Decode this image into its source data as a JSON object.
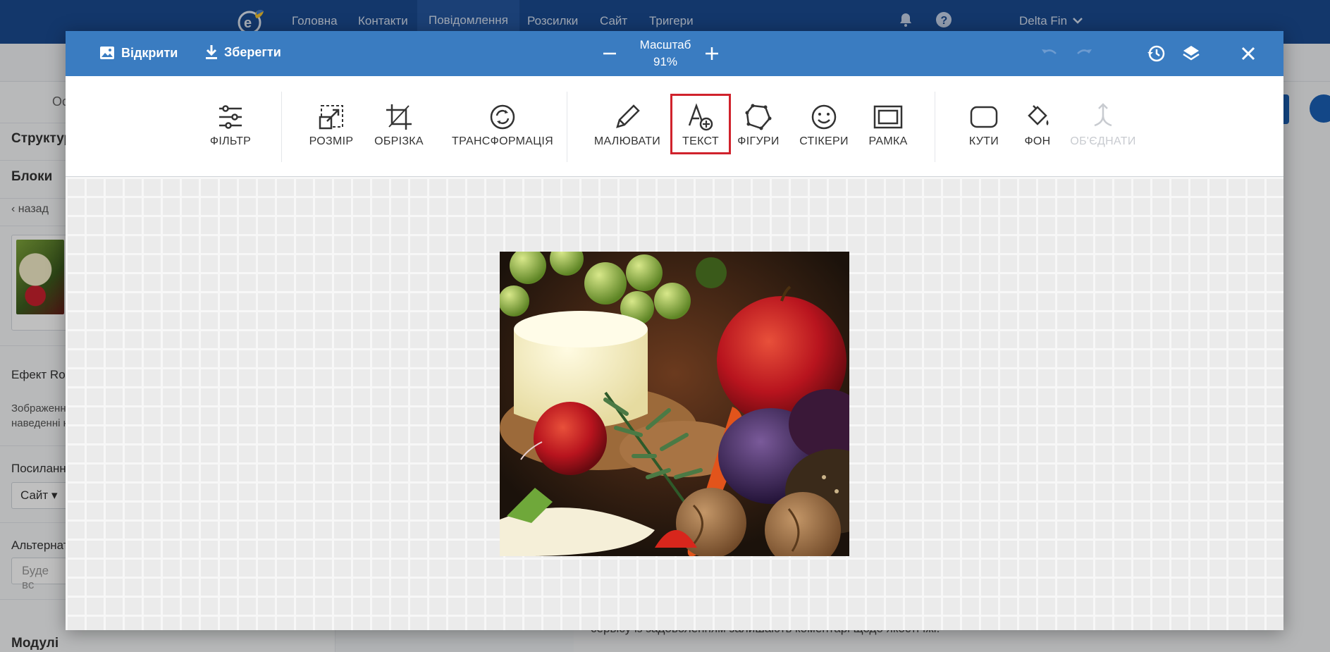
{
  "app_nav": {
    "items": [
      "Головна",
      "Контакти",
      "Повідомлення",
      "Розсилки",
      "Сайт",
      "Тригери"
    ],
    "user": "Delta Fin"
  },
  "left_panel": {
    "tab_partial": "Ос",
    "structure": "Структур",
    "blocks": "Блоки",
    "back": "назад",
    "effect": "Ефект Rol",
    "image_hint_1": "Зображенн",
    "image_hint_2": "наведенні к",
    "link_label": "Посиланн",
    "link_select": "Сайт",
    "alt_label": "Альтернат",
    "alt_placeholder": "Буде вс",
    "modules": "Модулі"
  },
  "background_content": {
    "text_line": "сервісу із задоволенням залишають коментарі щодо якості їжі."
  },
  "editor": {
    "header": {
      "open_label": "Відкрити",
      "save_label": "Зберегти",
      "zoom_title": "Масштаб",
      "zoom_value": "91%"
    },
    "tools": {
      "filter": "ФІЛЬТР",
      "resize": "РОЗМІР",
      "crop": "ОБРІЗКА",
      "transform": "ТРАНСФОРМАЦІЯ",
      "draw": "МАЛЮВАТИ",
      "text": "ТЕКСТ",
      "shapes": "ФІГУРИ",
      "stickers": "СТІКЕРИ",
      "frame": "РАМКА",
      "corners": "КУТИ",
      "background": "ФОН",
      "merge": "ОБ'ЄДНАТИ"
    },
    "selected_tool": "text",
    "merge_disabled": true
  },
  "colors": {
    "nav_bg": "#1a4a8f",
    "modal_header": "#3a7cc1",
    "highlight": "#d0222c"
  }
}
